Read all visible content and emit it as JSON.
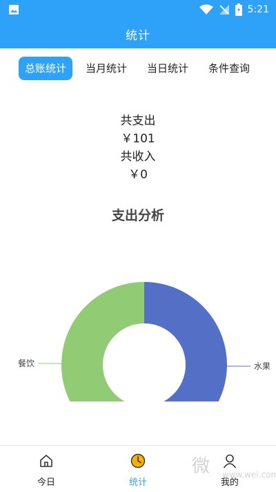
{
  "status_bar": {
    "time": "5:21"
  },
  "app_bar": {
    "title": "统计"
  },
  "tabs": [
    {
      "label": "总账统计",
      "active": true
    },
    {
      "label": "当月统计",
      "active": false
    },
    {
      "label": "当日统计",
      "active": false
    },
    {
      "label": "条件查询",
      "active": false
    }
  ],
  "summary": {
    "expense_label": "共支出",
    "expense_value": "￥101",
    "income_label": "共收入",
    "income_value": "￥0"
  },
  "analysis": {
    "title": "支出分析"
  },
  "chart_data": {
    "type": "pie",
    "title": "支出分析",
    "categories": [
      "水果",
      "餐饮"
    ],
    "values": [
      51,
      50
    ],
    "colors": [
      "#5470c6",
      "#91cc75"
    ],
    "legend": "none"
  },
  "bottom_nav": [
    {
      "label": "今日",
      "icon": "home-icon",
      "active": false
    },
    {
      "label": "统计",
      "icon": "clock-icon",
      "active": true
    },
    {
      "label": "我的",
      "icon": "user-icon",
      "active": false
    }
  ],
  "watermark": {
    "text": "微",
    "url": "www.wei.com"
  },
  "colors": {
    "primary": "#2ea2f8",
    "accent": "#f6b100"
  }
}
